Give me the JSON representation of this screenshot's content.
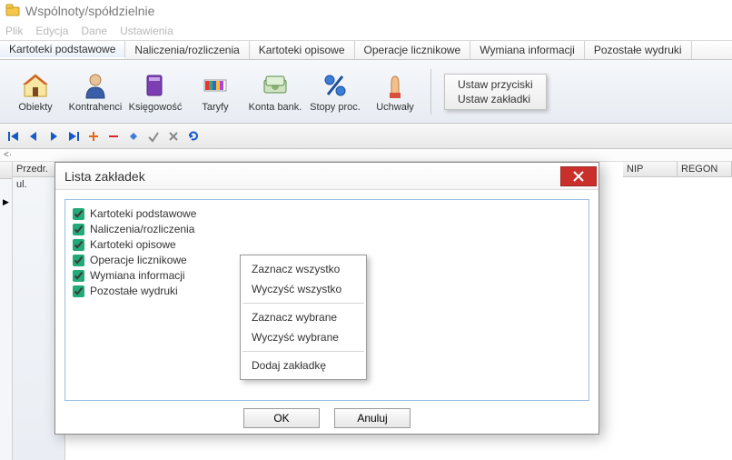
{
  "window": {
    "title": "Wspólnoty/spółdzielnie"
  },
  "menu": {
    "items": [
      "Plik",
      "Edycja",
      "Dane",
      "Ustawienia"
    ]
  },
  "tabs": {
    "items": [
      "Kartoteki podstawowe",
      "Naliczenia/rozliczenia",
      "Kartoteki opisowe",
      "Operacje licznikowe",
      "Wymiana informacji",
      "Pozostałe wydruki"
    ],
    "active_index": 0
  },
  "ribbon": {
    "buttons": [
      {
        "id": "obiekty",
        "label": "Obiekty"
      },
      {
        "id": "kontrahenci",
        "label": "Kontrahenci"
      },
      {
        "id": "ksiegowosc",
        "label": "Księgowość"
      },
      {
        "id": "taryfy",
        "label": "Taryfy"
      },
      {
        "id": "konta-bank",
        "label": "Konta bank."
      },
      {
        "id": "stopy-proc",
        "label": "Stopy proc."
      },
      {
        "id": "uchwaly",
        "label": "Uchwały"
      }
    ],
    "side": {
      "item1": "Ustaw przyciski",
      "item2": "Ustaw zakładki"
    }
  },
  "grid": {
    "left_header": "Przedr.",
    "left_cell": "ul.",
    "col_nip": "NIP",
    "col_regon": "REGON"
  },
  "modal": {
    "title": "Lista zakładek",
    "checks": [
      {
        "label": "Kartoteki podstawowe",
        "checked": true
      },
      {
        "label": "Naliczenia/rozliczenia",
        "checked": true
      },
      {
        "label": "Kartoteki opisowe",
        "checked": true
      },
      {
        "label": "Operacje licznikowe",
        "checked": true
      },
      {
        "label": "Wymiana informacji",
        "checked": true
      },
      {
        "label": "Pozostałe wydruki",
        "checked": true
      }
    ],
    "ok": "OK",
    "cancel": "Anuluj"
  },
  "context_menu": {
    "items": [
      "Zaznacz wszystko",
      "Wyczyść wszystko",
      "-",
      "Zaznacz wybrane",
      "Wyczyść wybrane",
      "-",
      "Dodaj zakładkę"
    ]
  }
}
